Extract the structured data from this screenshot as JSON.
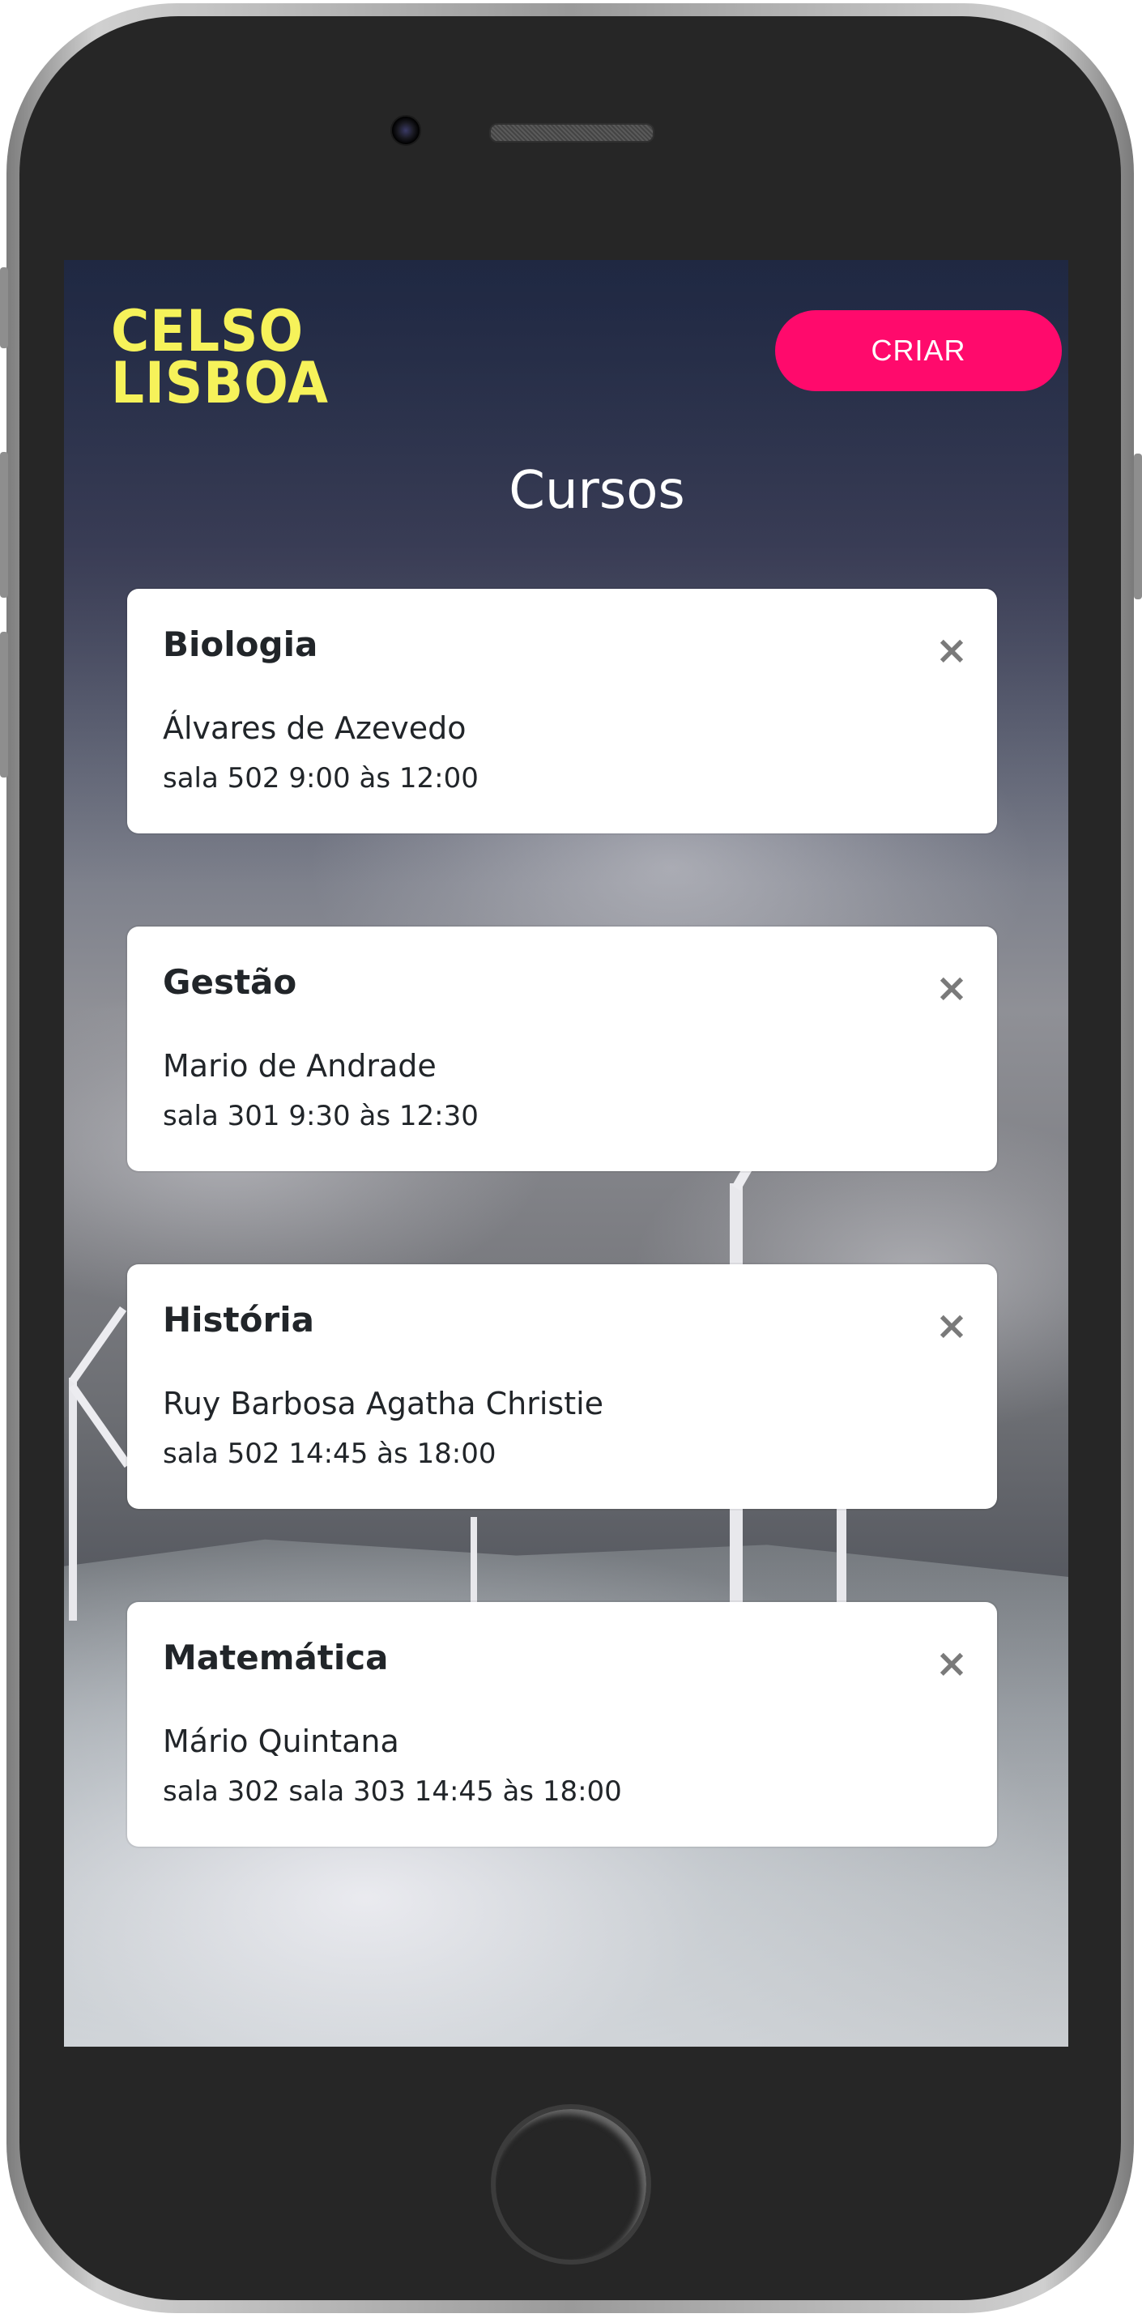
{
  "header": {
    "logo_line1": "CELSO",
    "logo_line2": "LISBOA",
    "create_button": "CRIAR"
  },
  "page_title": "Cursos",
  "courses": [
    {
      "title": "Biologia",
      "teacher": "Álvares de Azevedo",
      "schedule": "sala 502 9:00 às 12:00"
    },
    {
      "title": "Gestão",
      "teacher": "Mario de Andrade",
      "schedule": "sala 301 9:30 às 12:30"
    },
    {
      "title": "História",
      "teacher": "Ruy Barbosa Agatha Christie",
      "schedule": "sala 502 14:45 às 18:00"
    },
    {
      "title": "Matemática",
      "teacher": "Mário Quintana",
      "schedule": "sala 302 sala 303 14:45 às 18:00"
    }
  ],
  "icons": {
    "close": "close-icon",
    "logo": "celso-lisboa-logo"
  },
  "colors": {
    "accent": "#ff0a6c",
    "logo": "#f6f25a"
  }
}
